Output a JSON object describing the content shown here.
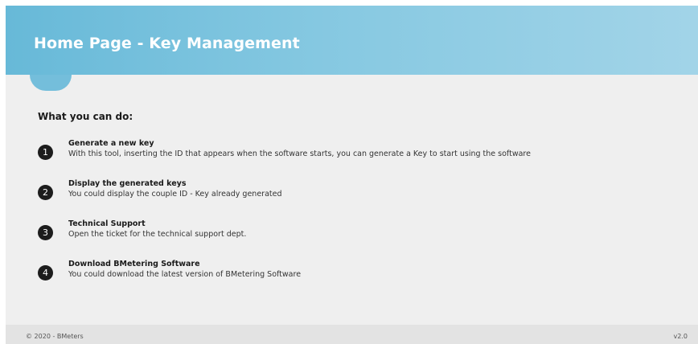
{
  "header": {
    "title": "Home Page - Key Management"
  },
  "main": {
    "heading": "What you can do:",
    "items": [
      {
        "number": "1",
        "title": "Generate a new key",
        "description": "With this tool, inserting the ID that appears when the software starts, you can generate a Key to start using the software"
      },
      {
        "number": "2",
        "title": "Display the generated keys",
        "description": "You could display the couple ID - Key already generated"
      },
      {
        "number": "3",
        "title": "Technical Support",
        "description": "Open the ticket for the technical support dept."
      },
      {
        "number": "4",
        "title": "Download BMetering Software",
        "description": "You could download the latest version of BMetering Software"
      }
    ]
  },
  "footer": {
    "copyright": "© 2020 - BMeters",
    "version": "v2.0"
  },
  "colors": {
    "header_gradient_start": "#67b9d8",
    "header_gradient_end": "#a2d4e8",
    "background": "#efefef",
    "badge": "#1c1c1c"
  }
}
